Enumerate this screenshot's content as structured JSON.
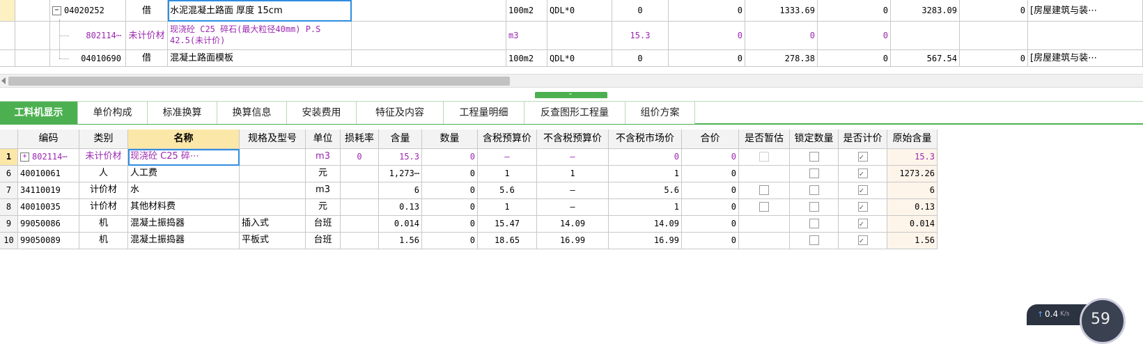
{
  "upper_rows": [
    {
      "code": "04020252",
      "type": "借",
      "name": "水泥混凝土路面 厚度 15cm",
      "unit": "100m2",
      "formula": "QDL*0",
      "qty": "0",
      "v1": "0",
      "v2": "1333.69",
      "v3": "0",
      "v4": "3283.09",
      "v5": "0",
      "prof": "[房屋建筑与装⋯",
      "prof2": "房屋建"
    },
    {
      "code": "802114⋯",
      "type": "未计价材",
      "name_line1": "现浇砼 C25 碎石(最大粒径40mm) P.S",
      "name_line2": "42.5(未计价)",
      "unit": "m3",
      "qty": "15.3",
      "v1": "0",
      "v2": "0",
      "v3": "0"
    },
    {
      "code": "04010690",
      "type": "借",
      "name": "混凝土路面模板",
      "unit": "100m2",
      "formula": "QDL*0",
      "qty": "0",
      "v1": "0",
      "v2": "278.38",
      "v3": "0",
      "v4": "567.54",
      "v5": "0",
      "prof": "[房屋建筑与装⋯",
      "prof2": "房屋建"
    }
  ],
  "tree_expand_symbol": "−",
  "tabs": [
    "工料机显示",
    "单价构成",
    "标准换算",
    "换算信息",
    "安装费用",
    "特征及内容",
    "工程量明细",
    "反查图形工程量",
    "组价方案"
  ],
  "columns": [
    "编码",
    "类别",
    "名称",
    "规格及型号",
    "单位",
    "损耗率",
    "含量",
    "数量",
    "含税预算价",
    "不含税预算价",
    "不含税市场价",
    "合价",
    "是否暂估",
    "锁定数量",
    "是否计价",
    "原始含量"
  ],
  "rows": [
    {
      "idx": "1",
      "code": "802114⋯",
      "type": "未计价材",
      "name": "现浇砼 C25 碎⋯",
      "spec": "",
      "unit": "m3",
      "loss": "0",
      "content": "15.3",
      "qty": "0",
      "tax_price": "—",
      "notax_price": "—",
      "market": "0",
      "total": "0",
      "temp": "disabled",
      "lock": "unchecked",
      "priced": "checked",
      "orig": "15.3",
      "expand": "+"
    },
    {
      "idx": "6",
      "code": "40010061",
      "type": "人",
      "name": "人工费",
      "spec": "",
      "unit": "元",
      "loss": "",
      "content": "1,273⋯",
      "qty": "0",
      "tax_price": "1",
      "notax_price": "1",
      "market": "1",
      "total": "0",
      "temp": "none",
      "lock": "unchecked",
      "priced": "checked",
      "orig": "1273.26"
    },
    {
      "idx": "7",
      "code": "34110019",
      "type": "计价材",
      "name": "水",
      "spec": "",
      "unit": "m3",
      "loss": "",
      "content": "6",
      "qty": "0",
      "tax_price": "5.6",
      "notax_price": "—",
      "market": "5.6",
      "total": "0",
      "temp": "unchecked",
      "lock": "unchecked",
      "priced": "checked",
      "orig": "6"
    },
    {
      "idx": "8",
      "code": "40010035",
      "type": "计价材",
      "name": "其他材料费",
      "spec": "",
      "unit": "元",
      "loss": "",
      "content": "0.13",
      "qty": "0",
      "tax_price": "1",
      "notax_price": "—",
      "market": "1",
      "total": "0",
      "temp": "unchecked",
      "lock": "unchecked",
      "priced": "checked",
      "orig": "0.13"
    },
    {
      "idx": "9",
      "code": "99050086",
      "type": "机",
      "name": "混凝土振捣器",
      "spec": "插入式",
      "unit": "台班",
      "loss": "",
      "content": "0.014",
      "qty": "0",
      "tax_price": "15.47",
      "notax_price": "14.09",
      "market": "14.09",
      "total": "0",
      "temp": "none",
      "lock": "unchecked",
      "priced": "checked",
      "orig": "0.014"
    },
    {
      "idx": "10",
      "code": "99050089",
      "type": "机",
      "name": "混凝土振捣器",
      "spec": "平板式",
      "unit": "台班",
      "loss": "",
      "content": "1.56",
      "qty": "0",
      "tax_price": "18.65",
      "notax_price": "16.99",
      "market": "16.99",
      "total": "0",
      "temp": "none",
      "lock": "unchecked",
      "priced": "checked",
      "orig": "1.56"
    }
  ],
  "edit_button_label": "⋯",
  "net_widget": {
    "speed": "0.4",
    "unit": "K/s",
    "arrow": "↑",
    "gauge_value": "59"
  }
}
